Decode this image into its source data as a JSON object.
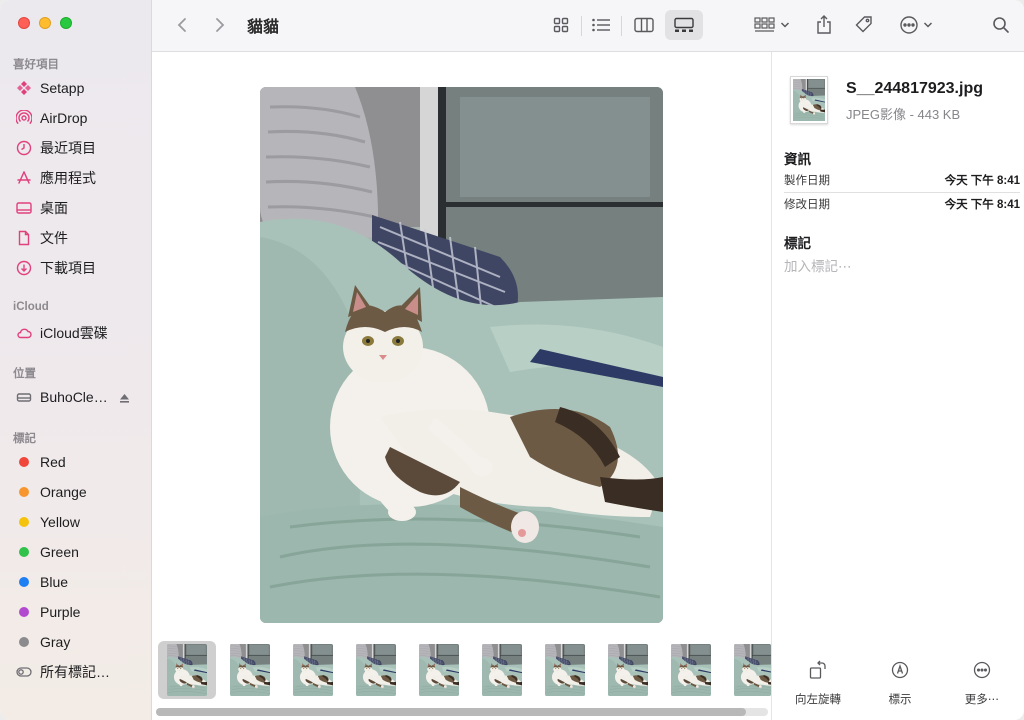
{
  "window": {
    "title": "貓貓"
  },
  "sidebar": {
    "favorites_title": "喜好項目",
    "favorites": [
      {
        "label": "Setapp",
        "icon": "setapp-icon"
      },
      {
        "label": "AirDrop",
        "icon": "airdrop-icon"
      },
      {
        "label": "最近項目",
        "icon": "clock-icon"
      },
      {
        "label": "應用程式",
        "icon": "applications-icon"
      },
      {
        "label": "桌面",
        "icon": "desktop-icon"
      },
      {
        "label": "文件",
        "icon": "document-icon"
      },
      {
        "label": "下載項目",
        "icon": "download-icon"
      }
    ],
    "icloud_title": "iCloud",
    "icloud": [
      {
        "label": "iCloud雲碟",
        "icon": "cloud-icon"
      }
    ],
    "locations_title": "位置",
    "locations": [
      {
        "label": "BuhoCle…",
        "icon": "drive-icon"
      }
    ],
    "tags_title": "標記",
    "tags": [
      {
        "label": "Red",
        "color": "#f0453a"
      },
      {
        "label": "Orange",
        "color": "#f7962e"
      },
      {
        "label": "Yellow",
        "color": "#f6c30c"
      },
      {
        "label": "Green",
        "color": "#31c24a"
      },
      {
        "label": "Blue",
        "color": "#1e7ff3"
      },
      {
        "label": "Purple",
        "color": "#b24ad0"
      },
      {
        "label": "Gray",
        "color": "#8b8b8e"
      }
    ],
    "all_tags": "所有標記…",
    "accent_color": "#e2407d"
  },
  "toolbar": {
    "view_modes": [
      "icon-view",
      "list-view",
      "column-view",
      "gallery-view"
    ],
    "selected_view": "gallery-view"
  },
  "inspector": {
    "filename": "S__244817923.jpg",
    "kind": "JPEG影像 - 443 KB",
    "info_title": "資訊",
    "created_label": "製作日期",
    "created_value": "今天 下午 8:41",
    "modified_label": "修改日期",
    "modified_value": "今天 下午 8:41",
    "tags_title": "標記",
    "tags_placeholder": "加入標記⋯",
    "actions": [
      {
        "label": "向左旋轉",
        "icon": "rotate-left-icon"
      },
      {
        "label": "標示",
        "icon": "markup-icon"
      },
      {
        "label": "更多⋯",
        "icon": "more-icon"
      }
    ]
  },
  "gallery": {
    "thumbnail_count": 10,
    "selected_index": 0
  }
}
